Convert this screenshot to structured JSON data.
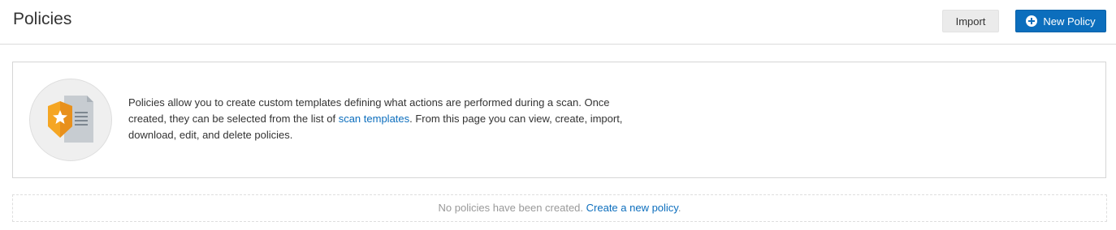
{
  "header": {
    "title": "Policies",
    "import_label": "Import",
    "new_policy_label": "New Policy"
  },
  "info": {
    "text_before_link": "Policies allow you to create custom templates defining what actions are performed during a scan. Once created, they can be selected from the list of ",
    "link_label": "scan templates",
    "text_after_link": ". From this page you can view, create, import, download, edit, and delete policies."
  },
  "empty_state": {
    "message": "No policies have been created. ",
    "link_label": "Create a new policy",
    "suffix": "."
  },
  "icons": {
    "new_policy": "plus-circle-icon",
    "policy": "policy-document-icon"
  },
  "colors": {
    "primary": "#0c6ebd",
    "shield": "#f5a623",
    "document": "#c7ccd1"
  }
}
